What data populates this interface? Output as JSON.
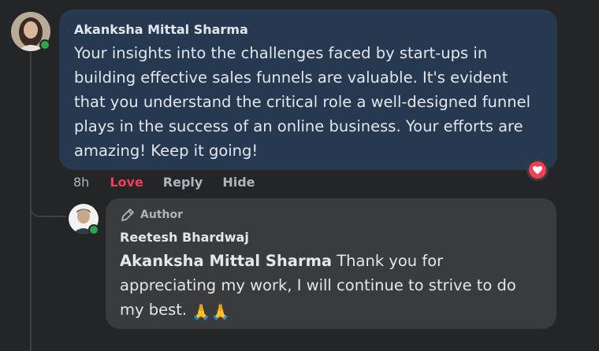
{
  "comment": {
    "author": "Akanksha Mittal Sharma",
    "text": "Your insights into the challenges faced by start-ups in building effective sales funnels are valuable. It's evident that you understand the critical role a well-designed funnel plays in the success of an online business. Your efforts are amazing! Keep it going!",
    "time": "8h",
    "actions": {
      "love": "Love",
      "reply": "Reply",
      "hide": "Hide"
    },
    "reaction_icon": "heart-icon"
  },
  "reply": {
    "badge": "Author",
    "badge_icon": "pen-icon",
    "author": "Reetesh Bhardwaj",
    "mention": "Akanksha Mittal Sharma",
    "text": " Thank you for appreciating my work, I will continue to strive to do my best. ",
    "emoji": "🙏🙏"
  },
  "colors": {
    "background": "#242526",
    "comment_bubble": "#263951",
    "reply_bubble": "#3a3b3c",
    "love": "#f33e58",
    "online": "#31a24c"
  }
}
